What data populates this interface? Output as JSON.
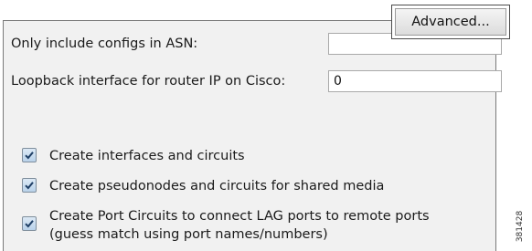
{
  "form": {
    "asn_label": "Only include configs in ASN:",
    "asn_value": "",
    "loopback_label": "Loopback interface for router IP on Cisco:",
    "loopback_value": "0"
  },
  "advanced_button": {
    "label": "Advanced..."
  },
  "checkboxes": [
    {
      "label": "Create interfaces and circuits",
      "checked": true
    },
    {
      "label": "Create pseudonodes and circuits for shared media",
      "checked": true
    },
    {
      "label_line1": "Create Port Circuits to connect LAG ports to remote ports",
      "label_line2": "(guess match using port names/numbers)",
      "checked": true
    }
  ],
  "figure_id": "381428",
  "colors": {
    "panel_background": "#f1f1f1",
    "checkbox_fill": "#b9d2ea",
    "checkmark": "#1f3f66"
  }
}
